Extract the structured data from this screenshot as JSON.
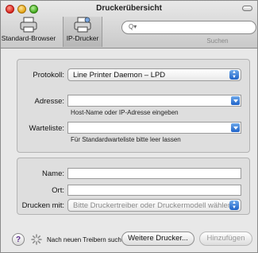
{
  "window": {
    "title": "Druckerübersicht"
  },
  "toolbar": {
    "standard_label": "Standard-Browser",
    "ip_label": "IP-Drucker",
    "search_placeholder": "",
    "search_label": "Suchen"
  },
  "form": {
    "protokoll_label": "Protokoll:",
    "protokoll_value": "Line Printer Daemon – LPD",
    "adresse_label": "Adresse:",
    "adresse_value": "",
    "adresse_hint": "Host-Name oder IP-Adresse eingeben",
    "warteliste_label": "Warteliste:",
    "warteliste_value": "",
    "warteliste_hint": "Für Standardwarteliste bitte leer lassen",
    "name_label": "Name:",
    "name_value": "",
    "ort_label": "Ort:",
    "ort_value": "",
    "drucken_label": "Drucken mit:",
    "drucken_value": "Bitte Druckertreiber oder Druckermodell wählen"
  },
  "footer": {
    "help": "?",
    "status": "Nach neuen Treibern suchen",
    "more_button": "Weitere Drucker...",
    "add_button": "Hinzufügen"
  },
  "colors": {
    "accent": "#1f63c8",
    "window_bg": "#e8e8e8"
  }
}
